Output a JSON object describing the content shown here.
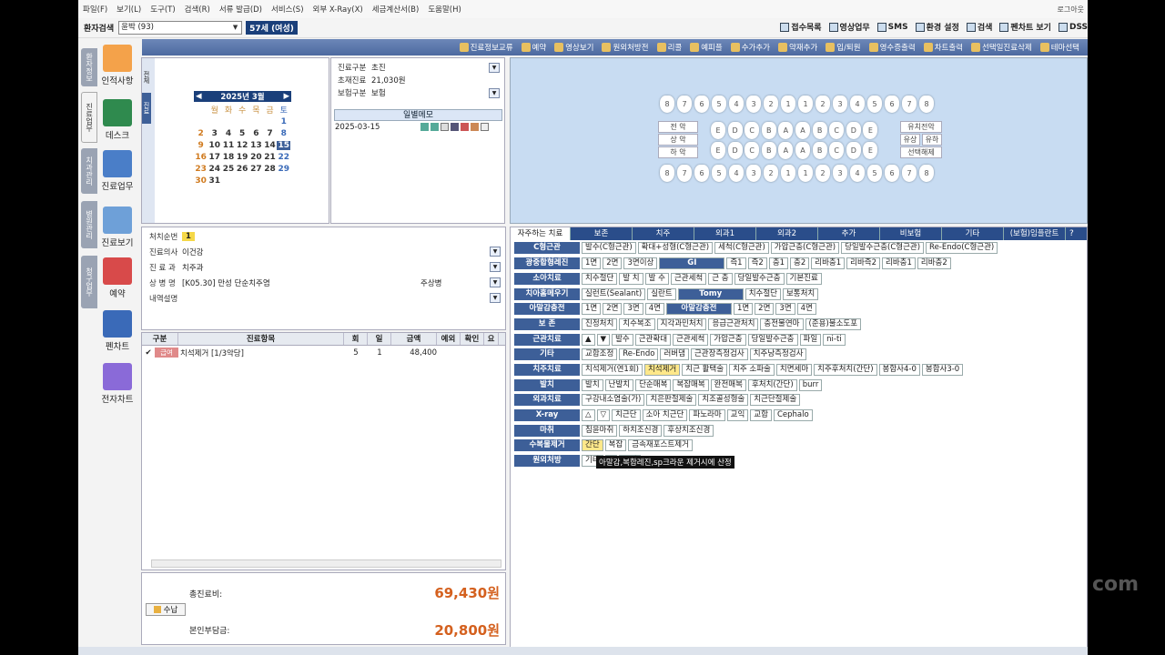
{
  "menu": [
    "파일(F)",
    "보기(L)",
    "도구(T)",
    "검색(R)",
    "서류 발급(D)",
    "서비스(S)",
    "외부 X-Ray(X)",
    "세금계산서(B)",
    "도움말(H)"
  ],
  "logout": "로그아웃",
  "patient": {
    "search_label": "환자검색",
    "name": "윤박 (93)",
    "age": "57세 (여성)"
  },
  "tools": [
    "접수목록",
    "영상업무",
    "SMS",
    "환경 설정",
    "검색",
    "펜차트 보기",
    "DSS"
  ],
  "toolbar2": [
    "진료정보교류",
    "예약",
    "영상보기",
    "원외처방전",
    "리콜",
    "예피플",
    "수가추가",
    "약재추가",
    "입/퇴원",
    "영수증출력",
    "차트출력",
    "선택일진료삭제",
    "테마선택"
  ],
  "sidebar": {
    "vtabs": [
      "환자정보",
      "진료업무",
      "치과관리",
      "병원관리",
      "청구업무"
    ],
    "nav": [
      "인적사항",
      "데스크",
      "진료업무",
      "진료보기",
      "예약",
      "펜차트",
      "전자차트"
    ]
  },
  "calendar": {
    "month_label": "2025년  3월",
    "weekdays": [
      "월",
      "화",
      "수",
      "목",
      "금",
      "토"
    ],
    "rows": [
      [
        "",
        "",
        "",
        "",
        "",
        "1"
      ],
      [
        "2",
        "3",
        "4",
        "5",
        "6",
        "7",
        "8"
      ],
      [
        "9",
        "10",
        "11",
        "12",
        "13",
        "14",
        "15"
      ],
      [
        "16",
        "17",
        "18",
        "19",
        "20",
        "21",
        "22"
      ],
      [
        "23",
        "24",
        "25",
        "26",
        "27",
        "28",
        "29"
      ],
      [
        "30",
        "31",
        "",
        "",
        "",
        "",
        ""
      ]
    ],
    "vtabs": [
      "전체",
      "진료"
    ]
  },
  "info": {
    "visit_type_label": "진료구분",
    "visit_type": "초진",
    "first_fee_label": "초재진료",
    "first_fee": "21,030원",
    "insurance_label": "보험구분",
    "insurance": "보험",
    "memo_title": "일별메모",
    "memo_date": "2025-03-15"
  },
  "teeth": {
    "upper_perm": [
      "8",
      "7",
      "6",
      "5",
      "4",
      "3",
      "2",
      "1",
      "1",
      "2",
      "3",
      "4",
      "5",
      "6",
      "7",
      "8"
    ],
    "upper_prim": [
      "E",
      "D",
      "C",
      "B",
      "A",
      "A",
      "B",
      "C",
      "D",
      "E"
    ],
    "lower_prim": [
      "E",
      "D",
      "C",
      "B",
      "A",
      "A",
      "B",
      "C",
      "D",
      "E"
    ],
    "lower_perm": [
      "8",
      "7",
      "6",
      "5",
      "4",
      "3",
      "2",
      "1",
      "1",
      "2",
      "3",
      "4",
      "5",
      "6",
      "7",
      "8"
    ],
    "left_boxes": [
      "전 악",
      "상 악",
      "하 악"
    ],
    "right_boxes": [
      "유치전악",
      "유상",
      "유하",
      "선택해제"
    ]
  },
  "treatment": {
    "order_label": "처치순번",
    "order": "1",
    "doctor_label": "진료의사",
    "doctor": "이건강",
    "dept_label": "진 료 과",
    "dept": "치주과",
    "disease_label": "상 병 명",
    "disease": "[K05.30] 만성 단순치주염",
    "disease_type": "주상병",
    "desc_label": "내역설명"
  },
  "list": {
    "headers": [
      "구분",
      "진료항목",
      "회",
      "일",
      "금액",
      "예외",
      "확인",
      "요"
    ],
    "row": {
      "type": "급여",
      "item": "치석제거 [1/3악당]",
      "count": "5",
      "day": "1",
      "amount": "48,400"
    }
  },
  "summary": {
    "total_label": "총진료비:",
    "total": "69,430원",
    "copay_label": "본인부담금:",
    "copay": "20,800원",
    "pay_button": "수납"
  },
  "cat_tabs": [
    "자주하는 치료",
    "보존",
    "치주",
    "외과1",
    "외과2",
    "추가",
    "비보험",
    "기타",
    "(보험)임플란트"
  ],
  "categories": [
    {
      "label": "C형근관",
      "items": [
        "발수(C형근관)",
        "확대+성형(C형근관)",
        "세척(C형근관)",
        "가압근충(C형근관)",
        "당일발수근충(C형근관)",
        "Re-Endo(C형근관)"
      ]
    },
    {
      "label": "광중합형레진",
      "items": [
        "1면",
        "2면",
        "3면이상"
      ],
      "dark": "GI",
      "items2": [
        "즉1",
        "즉2",
        "충1",
        "충2",
        "리바충1",
        "리바즉2",
        "리바충1",
        "리바충2"
      ]
    },
    {
      "label": "소아치료",
      "items": [
        "치수절단",
        "발 치",
        "발 수",
        "근관세척",
        "근 충",
        "당일발수근충",
        "기본진료"
      ]
    },
    {
      "label": "치아홈메우기",
      "items": [
        "실런트(Sealant)",
        "실란트"
      ],
      "dark": "Tomy",
      "items2": [
        "치수절단",
        "보통처치"
      ]
    },
    {
      "label": "아말감충전",
      "items": [
        "1면",
        "2면",
        "3면",
        "4면"
      ],
      "dark": "아말감충전",
      "items2": [
        "1면",
        "2면",
        "3면",
        "4면"
      ]
    },
    {
      "label": "보 존",
      "items": [
        "진정처치",
        "치수복조",
        "지각과민처치",
        "응급근관처치",
        "충전물연마",
        "(준용)불소도포"
      ]
    },
    {
      "label": "근관치료",
      "items": [
        "▲",
        "▼",
        "발수",
        "근관확대",
        "근관세척",
        "가압근충",
        "당일발수근충",
        "파일",
        "ni-ti"
      ]
    },
    {
      "label": "기타",
      "items": [
        "교합조정",
        "Re-Endo",
        "러버댐",
        "근관장측정검사",
        "치주낭측정검사"
      ]
    },
    {
      "label": "치주치료",
      "items": [
        "치석제거(연1회)",
        "치석제거",
        "치근 활택술",
        "치주 소파술",
        "치면세마",
        "치주후처치(간단)",
        "봉합사4-0",
        "봉합사3-0"
      ],
      "hl": 1
    },
    {
      "label": "발치",
      "items": [
        "발치",
        "난발치",
        "단순매복",
        "복잡매복",
        "완전매복",
        "후처치(간단)",
        "burr"
      ]
    },
    {
      "label": "외과치료",
      "items": [
        "구강내소염술(가)",
        "치은판절제술",
        "치조골성형술",
        "치근단절제술"
      ]
    },
    {
      "label": "X-ray",
      "items": [
        "△",
        "▽",
        "치근단",
        "소아 치근단",
        "파노라마",
        "교익",
        "교합",
        "Cephalo"
      ]
    },
    {
      "label": "마취",
      "items": [
        "침윤마취",
        "하치조신경",
        "후상치조신경"
      ]
    },
    {
      "label": "수복물제거",
      "items": [
        "간단",
        "복잡",
        "금속재포스트제거"
      ],
      "hl": 0
    },
    {
      "label": "원외처방",
      "items": [
        "기타",
        "B",
        "주사"
      ]
    }
  ],
  "tooltip": "아말감,복합레진,sp크라운 제거시에 산정",
  "watermark": "com"
}
